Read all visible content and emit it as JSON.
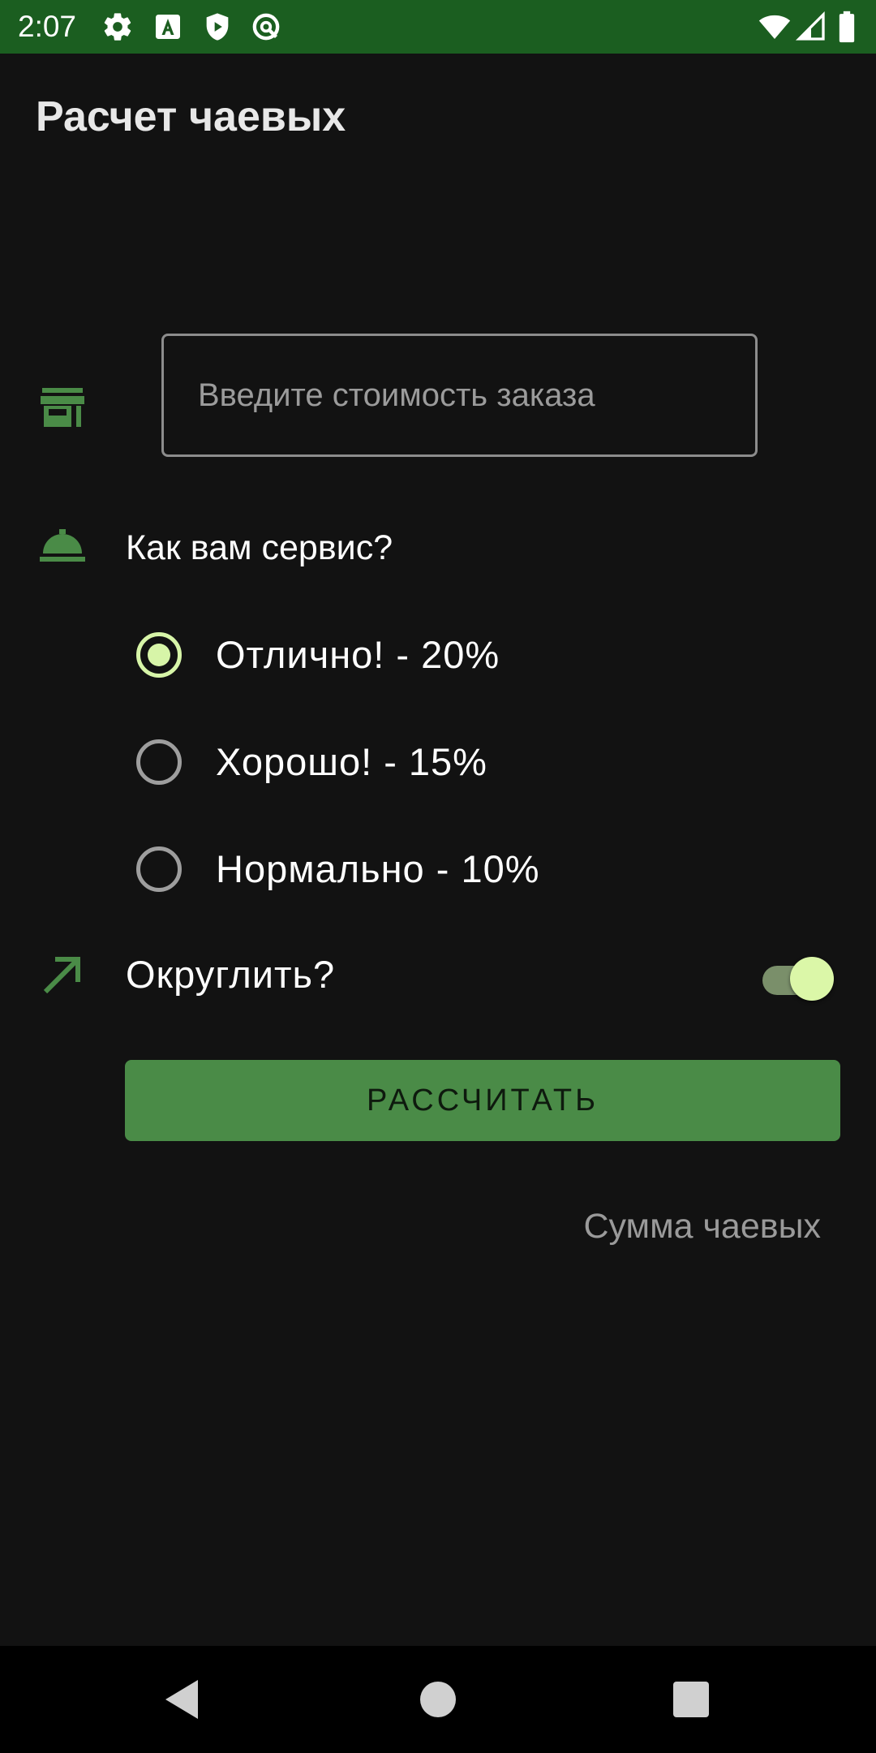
{
  "status_bar": {
    "time": "2:07",
    "background": "#1b5e20",
    "left_icons": [
      "settings-icon",
      "font-a-icon",
      "shield-play-icon",
      "data-saver-icon"
    ],
    "right_icons": [
      "wifi-icon",
      "signal-icon",
      "battery-icon"
    ]
  },
  "app": {
    "title": "Расчет чаевых",
    "accent_color": "#4a8b47"
  },
  "cost_field": {
    "icon": "store-icon",
    "placeholder": "Введите стоимость заказа",
    "value": ""
  },
  "service": {
    "icon": "room-service-icon",
    "question": "Как вам сервис?",
    "options": [
      {
        "label": "Отлично! - 20%",
        "checked": true
      },
      {
        "label": "Хорошо! - 15%",
        "checked": false
      },
      {
        "label": "Нормально - 10%",
        "checked": false
      }
    ]
  },
  "round_up": {
    "icon": "trending-up-icon",
    "label": "Округлить?",
    "enabled": true
  },
  "calculate_button": {
    "label": "РАССЧИТАТЬ"
  },
  "result": {
    "text": "Сумма чаевых"
  },
  "nav_bar": {
    "buttons": [
      "back-icon",
      "home-icon",
      "recents-icon"
    ]
  }
}
